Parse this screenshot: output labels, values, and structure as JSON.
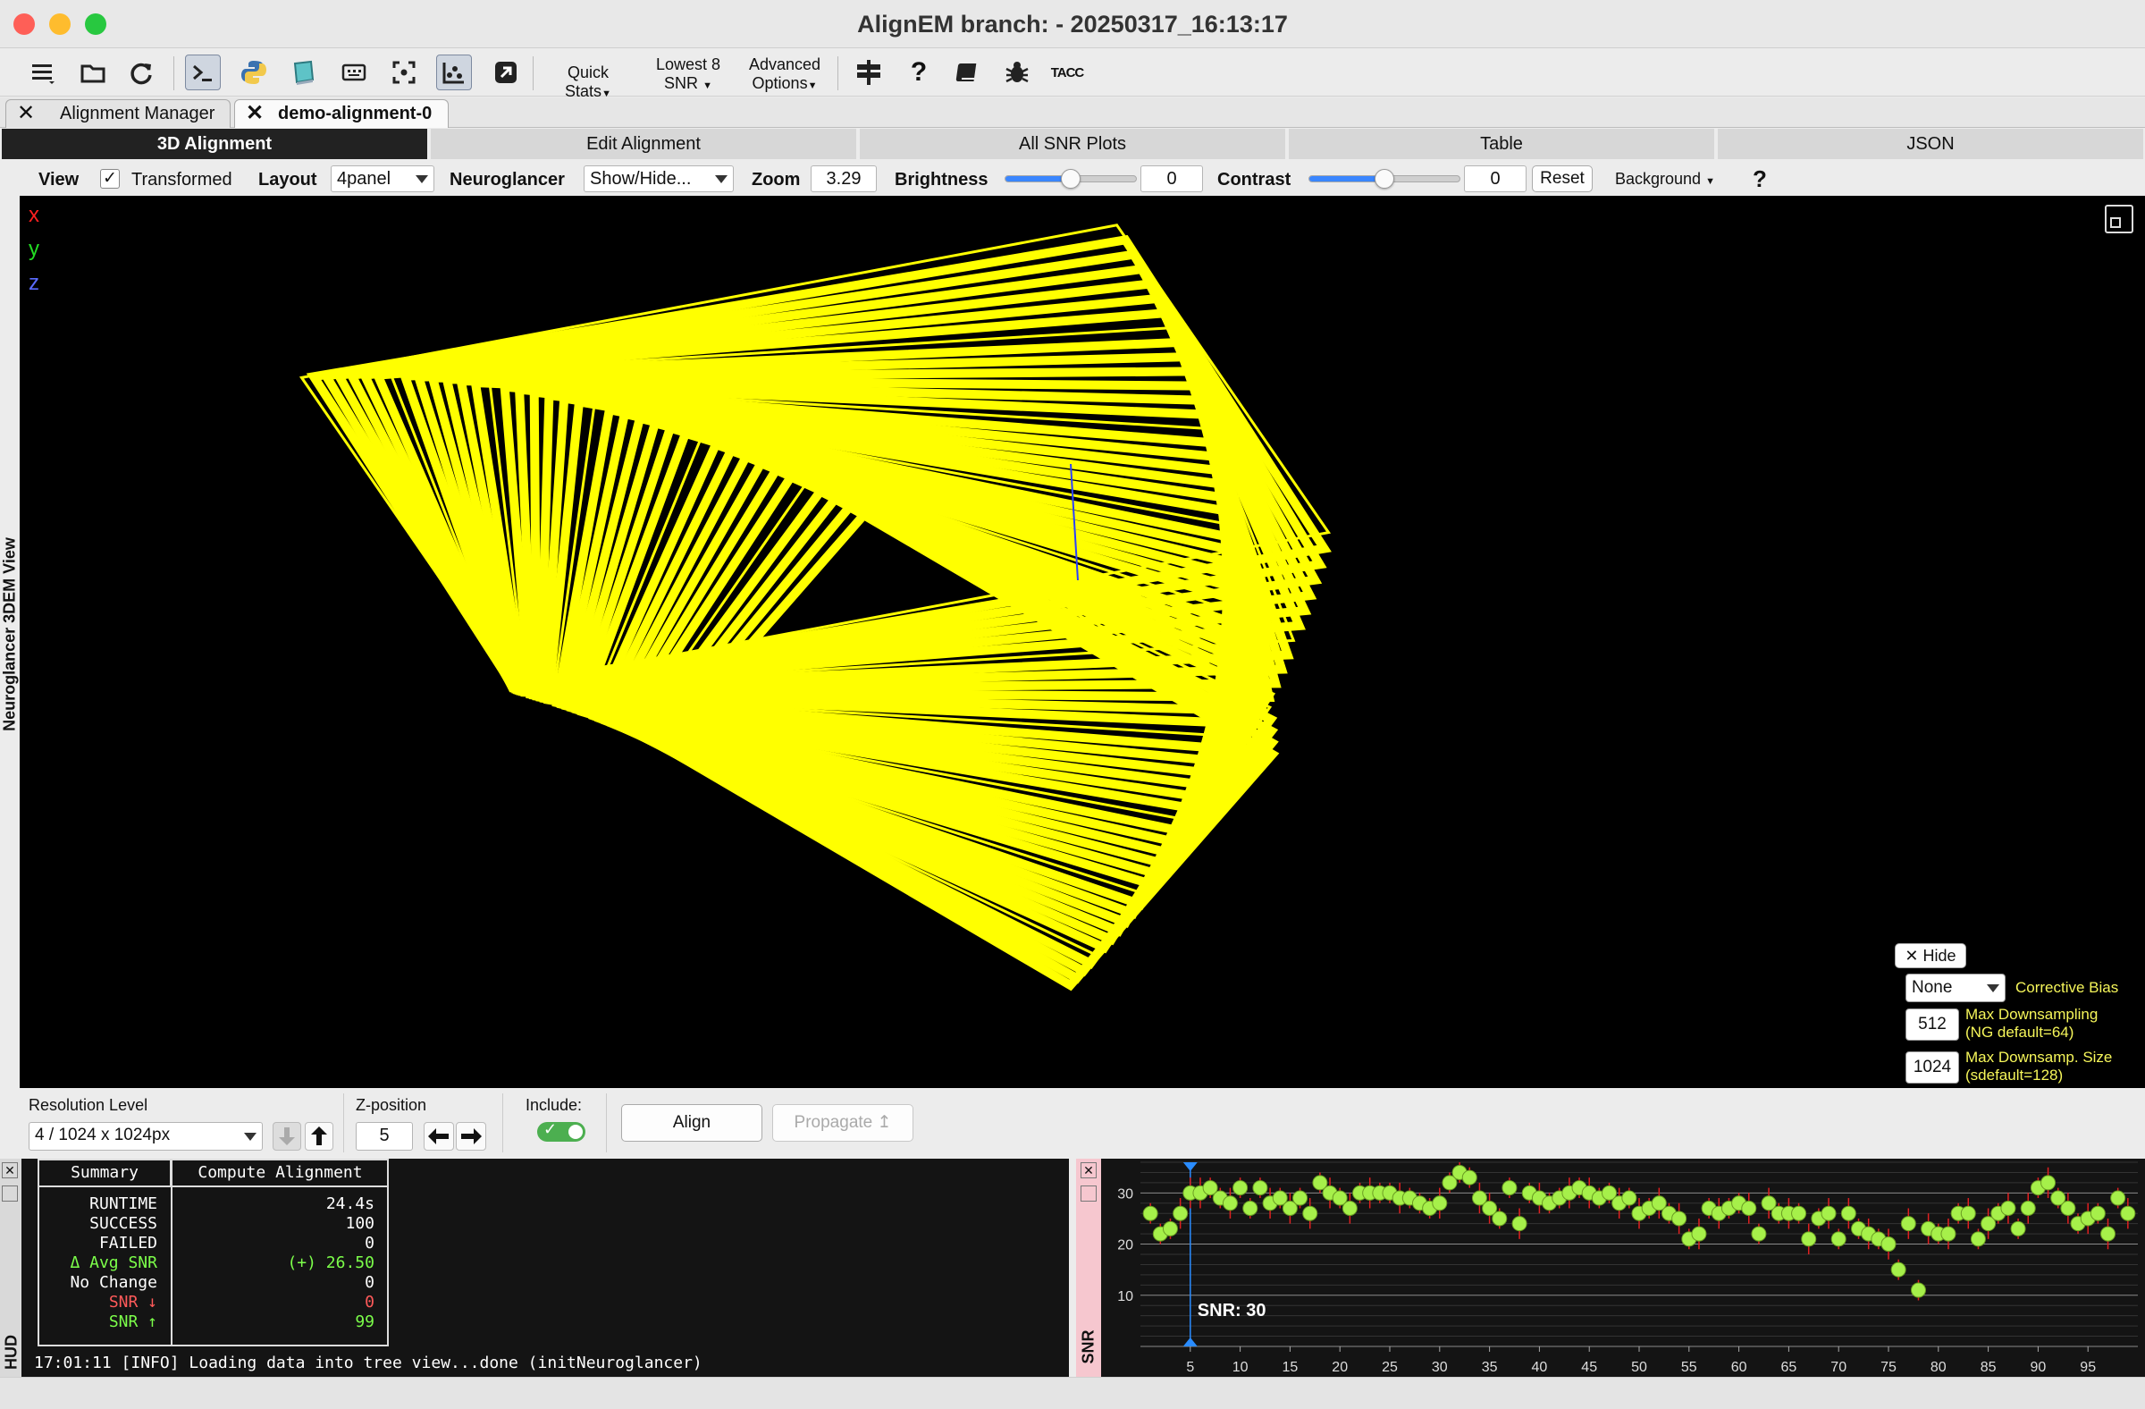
{
  "window": {
    "title": "AlignEM branch:  - 20250317_16:13:17"
  },
  "toolbar": {
    "quick_stats": "Quick Stats",
    "lowest8_line1": "Lowest 8",
    "lowest8_line2": "SNR",
    "advanced_line1": "Advanced",
    "advanced_line2": "Options",
    "tacc": "TACC"
  },
  "tabs": [
    {
      "label": "Alignment Manager"
    },
    {
      "label": "demo-alignment-0"
    }
  ],
  "segments": [
    "3D Alignment",
    "Edit Alignment",
    "All SNR Plots",
    "Table",
    "JSON"
  ],
  "viewbar": {
    "view": "View",
    "transformed": "Transformed",
    "layout_label": "Layout",
    "layout_value": "4panel",
    "neuroglancer_label": "Neuroglancer",
    "neuroglancer_value": "Show/Hide...",
    "zoom_label": "Zoom",
    "zoom_value": "3.29",
    "brightness_label": "Brightness",
    "brightness_value": "0",
    "brightness_level": 0.5,
    "contrast_label": "Contrast",
    "contrast_value": "0",
    "contrast_level": 0.5,
    "reset": "Reset",
    "background": "Background",
    "help": "?"
  },
  "viewer": {
    "side_label": "Neuroglancer 3DEM View",
    "axes": [
      "x",
      "y",
      "z"
    ],
    "axis_colors": [
      "#ff2020",
      "#22dd22",
      "#5a6bff"
    ],
    "frame_color": "#ffff00"
  },
  "bias_panel": {
    "hide": "Hide",
    "bias_value": "None",
    "bias_label": "Corrective Bias",
    "max_ds_value": "512",
    "max_ds_line1": "Max Downsampling",
    "max_ds_line2": "(NG default=64)",
    "max_size_value": "1024",
    "max_size_line1": "Max Downsamp. Size",
    "max_size_line2": "(sdefault=128)"
  },
  "controls": {
    "resolution_label": "Resolution Level",
    "resolution_value": "4 / 1024 x 1024px",
    "zpos_label": "Z-position",
    "zpos_value": "5",
    "include_label": "Include:",
    "align": "Align",
    "propagate": "Propagate"
  },
  "hud": {
    "label": "HUD",
    "summary_header": "Summary",
    "compute_header": "Compute Alignment",
    "rows": [
      {
        "label": "RUNTIME",
        "value": "24.4s",
        "color": "#ffffff"
      },
      {
        "label": "SUCCESS",
        "value": "100",
        "color": "#ffffff"
      },
      {
        "label": "FAILED",
        "value": "0",
        "color": "#ffffff"
      },
      {
        "label": "Δ Avg SNR",
        "value": "(+) 26.50",
        "color": "#7cff4a"
      },
      {
        "label": "No Change",
        "value": "0",
        "color": "#ffffff"
      },
      {
        "label": "SNR ↓",
        "value": "0",
        "color": "#ff5a5a"
      },
      {
        "label": "SNR ↑",
        "value": "99",
        "color": "#7cff4a"
      }
    ],
    "log_line": "17:01:11 [INFO] Loading data into tree view...done (initNeuroglancer)"
  },
  "snr_plot": {
    "label": "SNR",
    "readout": "SNR: 30"
  },
  "chart_data": {
    "type": "scatter",
    "ylabel": "SNR",
    "xlim": [
      0,
      100
    ],
    "ylim": [
      0,
      36
    ],
    "y_ticks": [
      10,
      20,
      30
    ],
    "x_ticks": [
      5,
      10,
      15,
      20,
      25,
      30,
      35,
      40,
      45,
      50,
      55,
      60,
      65,
      70,
      75,
      80,
      85,
      90,
      95
    ],
    "cursor_x": 5,
    "point_color": "#a6f04a",
    "error_color": "#e02020",
    "series": [
      {
        "x": [
          1,
          2,
          3,
          4,
          5,
          6,
          7,
          8,
          9,
          10,
          11,
          12,
          13,
          14,
          15,
          16,
          17,
          18,
          19,
          20,
          21,
          22,
          23,
          24,
          25,
          26,
          27,
          28,
          29,
          30,
          31,
          32,
          33,
          34,
          35,
          36,
          37,
          38,
          39,
          40,
          41,
          42,
          43,
          44,
          45,
          46,
          47,
          48,
          49,
          50,
          51,
          52,
          53,
          54,
          55,
          56,
          57,
          58,
          59,
          60,
          61,
          62,
          63,
          64,
          65,
          66,
          67,
          68,
          69,
          70,
          71,
          72,
          73,
          74,
          75,
          76,
          77,
          78,
          79,
          80,
          81,
          82,
          83,
          84,
          85,
          86,
          87,
          88,
          89,
          90,
          91,
          92,
          93,
          94,
          95,
          96,
          97,
          98,
          99
        ],
        "y": [
          26,
          22,
          23,
          26,
          30,
          30,
          31,
          29,
          28,
          31,
          27,
          31,
          28,
          29,
          27,
          29,
          26,
          32,
          30,
          29,
          27,
          30,
          30,
          30,
          30,
          29,
          29,
          28,
          27,
          28,
          32,
          34,
          33,
          29,
          27,
          25,
          31,
          24,
          30,
          29,
          28,
          29,
          30,
          31,
          30,
          29,
          30,
          28,
          29,
          26,
          27,
          28,
          26,
          25,
          21,
          22,
          27,
          26,
          27,
          28,
          27,
          22,
          28,
          26,
          26,
          26,
          21,
          25,
          26,
          21,
          26,
          23,
          22,
          21,
          20,
          15,
          24,
          11,
          23,
          22,
          22,
          26,
          26,
          21,
          24,
          26,
          27,
          23,
          27,
          31,
          32,
          29,
          27,
          24,
          25,
          26,
          22,
          29,
          26
        ],
        "err": [
          2,
          2,
          2,
          3,
          3,
          3,
          2,
          2,
          3,
          2,
          2,
          2,
          3,
          2,
          3,
          2,
          3,
          2,
          3,
          2,
          3,
          2,
          3,
          2,
          2,
          3,
          2,
          2,
          2,
          3,
          2,
          2,
          2,
          3,
          3,
          2,
          2,
          3,
          2,
          3,
          2,
          2,
          3,
          2,
          3,
          2,
          2,
          3,
          2,
          3,
          2,
          3,
          2,
          3,
          2,
          3,
          2,
          3,
          2,
          2,
          3,
          2,
          3,
          2,
          3,
          2,
          3,
          2,
          3,
          2,
          3,
          2,
          3,
          2,
          3,
          2,
          3,
          2,
          3,
          2,
          3,
          2,
          3,
          2,
          3,
          2,
          3,
          2,
          3,
          2,
          3,
          2,
          3,
          2,
          3,
          2,
          3,
          2,
          3
        ]
      }
    ]
  }
}
